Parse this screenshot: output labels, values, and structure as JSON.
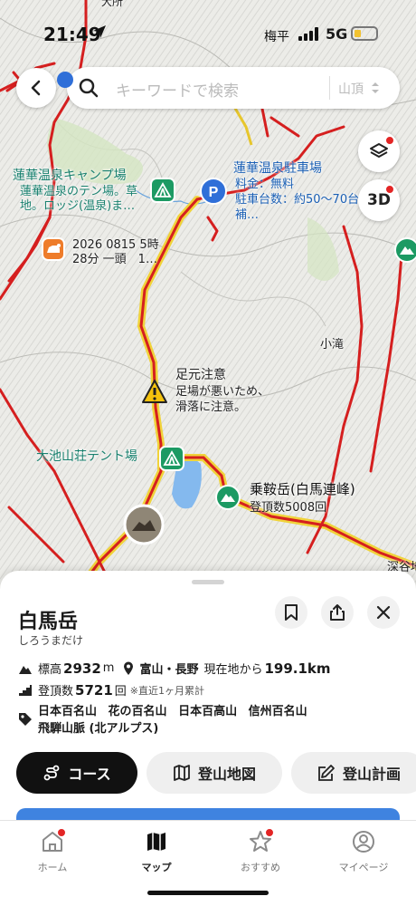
{
  "status": {
    "time": "21:49",
    "carrier": "梅平",
    "network": "5G"
  },
  "search": {
    "placeholder": "キーワードで検索",
    "filter": "山頂"
  },
  "map": {
    "top_label": "大所",
    "camp_label": [
      "蓮華温泉キャンプ場",
      "蓮華温泉のテン場。草",
      "地。ロッジ(温泉)ま…"
    ],
    "parking_label": [
      "蓮華温泉駐車場",
      "料金：無料",
      "駐車台数：約50〜70台",
      "補…"
    ],
    "activity_label": [
      "2026 0815 5時",
      "28分 一頭　1…"
    ],
    "warning_label": [
      "足元注意",
      "足場が悪いため、",
      "滑落に注意。"
    ],
    "place_label": "小滝",
    "tent_label": "大池山荘テント場",
    "summit_label": [
      "乗鞍岳(白馬連峰)",
      "登頂数5008回"
    ],
    "edge_label": "深谷地"
  },
  "mountain": {
    "name": "白馬岳",
    "kana": "しろうまだけ",
    "elevation_label": "標高",
    "elevation_value": "2932",
    "elevation_unit": "m",
    "prefecture": "富山・長野",
    "distance_label": "現在地から",
    "distance_value": "199.1km",
    "climbs_label": "登頂数",
    "climbs_value": "5721",
    "climbs_unit": "回",
    "climbs_note": "※直近1ヶ月累計",
    "tags": [
      "日本百名山",
      "花の百名山",
      "日本百高山",
      "信州百名山"
    ],
    "range": "飛騨山脈 (北アルプス)"
  },
  "actions": {
    "course": "コース",
    "map": "登山地図",
    "plan": "登山計画"
  },
  "tabs": {
    "home": "ホーム",
    "map": "マップ",
    "recommend": "おすすめ",
    "mypage": "マイページ"
  }
}
